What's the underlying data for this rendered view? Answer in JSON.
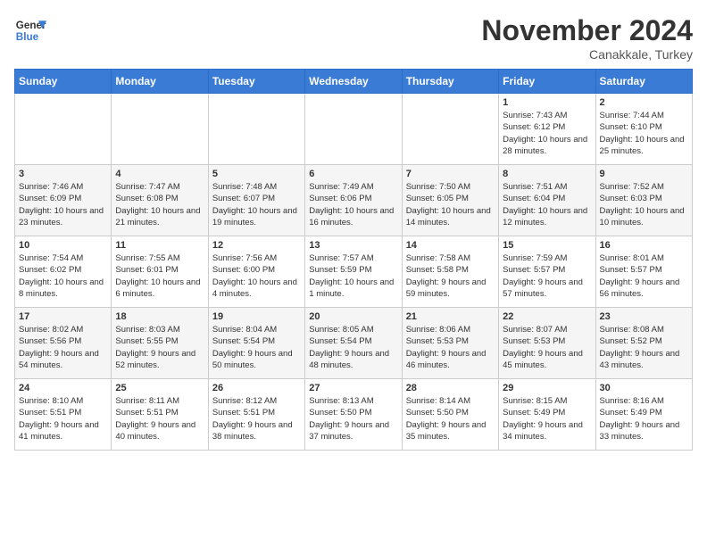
{
  "header": {
    "logo_general": "General",
    "logo_blue": "Blue",
    "month_title": "November 2024",
    "location": "Canakkale, Turkey"
  },
  "calendar": {
    "days_of_week": [
      "Sunday",
      "Monday",
      "Tuesday",
      "Wednesday",
      "Thursday",
      "Friday",
      "Saturday"
    ],
    "weeks": [
      [
        {
          "day": "",
          "info": ""
        },
        {
          "day": "",
          "info": ""
        },
        {
          "day": "",
          "info": ""
        },
        {
          "day": "",
          "info": ""
        },
        {
          "day": "",
          "info": ""
        },
        {
          "day": "1",
          "info": "Sunrise: 7:43 AM\nSunset: 6:12 PM\nDaylight: 10 hours and 28 minutes."
        },
        {
          "day": "2",
          "info": "Sunrise: 7:44 AM\nSunset: 6:10 PM\nDaylight: 10 hours and 25 minutes."
        }
      ],
      [
        {
          "day": "3",
          "info": "Sunrise: 7:46 AM\nSunset: 6:09 PM\nDaylight: 10 hours and 23 minutes."
        },
        {
          "day": "4",
          "info": "Sunrise: 7:47 AM\nSunset: 6:08 PM\nDaylight: 10 hours and 21 minutes."
        },
        {
          "day": "5",
          "info": "Sunrise: 7:48 AM\nSunset: 6:07 PM\nDaylight: 10 hours and 19 minutes."
        },
        {
          "day": "6",
          "info": "Sunrise: 7:49 AM\nSunset: 6:06 PM\nDaylight: 10 hours and 16 minutes."
        },
        {
          "day": "7",
          "info": "Sunrise: 7:50 AM\nSunset: 6:05 PM\nDaylight: 10 hours and 14 minutes."
        },
        {
          "day": "8",
          "info": "Sunrise: 7:51 AM\nSunset: 6:04 PM\nDaylight: 10 hours and 12 minutes."
        },
        {
          "day": "9",
          "info": "Sunrise: 7:52 AM\nSunset: 6:03 PM\nDaylight: 10 hours and 10 minutes."
        }
      ],
      [
        {
          "day": "10",
          "info": "Sunrise: 7:54 AM\nSunset: 6:02 PM\nDaylight: 10 hours and 8 minutes."
        },
        {
          "day": "11",
          "info": "Sunrise: 7:55 AM\nSunset: 6:01 PM\nDaylight: 10 hours and 6 minutes."
        },
        {
          "day": "12",
          "info": "Sunrise: 7:56 AM\nSunset: 6:00 PM\nDaylight: 10 hours and 4 minutes."
        },
        {
          "day": "13",
          "info": "Sunrise: 7:57 AM\nSunset: 5:59 PM\nDaylight: 10 hours and 1 minute."
        },
        {
          "day": "14",
          "info": "Sunrise: 7:58 AM\nSunset: 5:58 PM\nDaylight: 9 hours and 59 minutes."
        },
        {
          "day": "15",
          "info": "Sunrise: 7:59 AM\nSunset: 5:57 PM\nDaylight: 9 hours and 57 minutes."
        },
        {
          "day": "16",
          "info": "Sunrise: 8:01 AM\nSunset: 5:57 PM\nDaylight: 9 hours and 56 minutes."
        }
      ],
      [
        {
          "day": "17",
          "info": "Sunrise: 8:02 AM\nSunset: 5:56 PM\nDaylight: 9 hours and 54 minutes."
        },
        {
          "day": "18",
          "info": "Sunrise: 8:03 AM\nSunset: 5:55 PM\nDaylight: 9 hours and 52 minutes."
        },
        {
          "day": "19",
          "info": "Sunrise: 8:04 AM\nSunset: 5:54 PM\nDaylight: 9 hours and 50 minutes."
        },
        {
          "day": "20",
          "info": "Sunrise: 8:05 AM\nSunset: 5:54 PM\nDaylight: 9 hours and 48 minutes."
        },
        {
          "day": "21",
          "info": "Sunrise: 8:06 AM\nSunset: 5:53 PM\nDaylight: 9 hours and 46 minutes."
        },
        {
          "day": "22",
          "info": "Sunrise: 8:07 AM\nSunset: 5:53 PM\nDaylight: 9 hours and 45 minutes."
        },
        {
          "day": "23",
          "info": "Sunrise: 8:08 AM\nSunset: 5:52 PM\nDaylight: 9 hours and 43 minutes."
        }
      ],
      [
        {
          "day": "24",
          "info": "Sunrise: 8:10 AM\nSunset: 5:51 PM\nDaylight: 9 hours and 41 minutes."
        },
        {
          "day": "25",
          "info": "Sunrise: 8:11 AM\nSunset: 5:51 PM\nDaylight: 9 hours and 40 minutes."
        },
        {
          "day": "26",
          "info": "Sunrise: 8:12 AM\nSunset: 5:51 PM\nDaylight: 9 hours and 38 minutes."
        },
        {
          "day": "27",
          "info": "Sunrise: 8:13 AM\nSunset: 5:50 PM\nDaylight: 9 hours and 37 minutes."
        },
        {
          "day": "28",
          "info": "Sunrise: 8:14 AM\nSunset: 5:50 PM\nDaylight: 9 hours and 35 minutes."
        },
        {
          "day": "29",
          "info": "Sunrise: 8:15 AM\nSunset: 5:49 PM\nDaylight: 9 hours and 34 minutes."
        },
        {
          "day": "30",
          "info": "Sunrise: 8:16 AM\nSunset: 5:49 PM\nDaylight: 9 hours and 33 minutes."
        }
      ]
    ]
  }
}
